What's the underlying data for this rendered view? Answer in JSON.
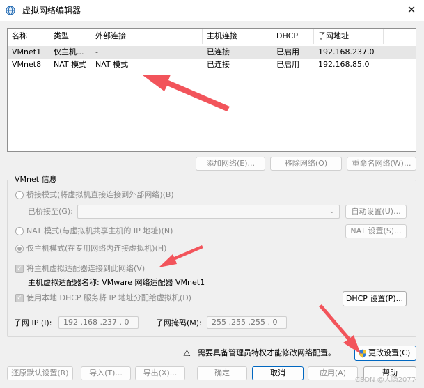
{
  "window": {
    "title": "虚拟网络编辑器",
    "close_glyph": "✕"
  },
  "table": {
    "columns": [
      "名称",
      "类型",
      "外部连接",
      "主机连接",
      "DHCP",
      "子网地址"
    ],
    "rows": [
      {
        "name": "VMnet1",
        "type": "仅主机...",
        "external": "-",
        "host": "已连接",
        "dhcp": "已启用",
        "subnet": "192.168.237.0",
        "selected": true
      },
      {
        "name": "VMnet8",
        "type": "NAT 模式",
        "external": "NAT 模式",
        "host": "已连接",
        "dhcp": "已启用",
        "subnet": "192.168.85.0",
        "selected": false
      }
    ]
  },
  "list_buttons": {
    "add": "添加网络(E)...",
    "remove": "移除网络(O)",
    "rename": "重命名网络(W)..."
  },
  "vmnet": {
    "group_label": "VMnet 信息",
    "bridged": "桥接模式(将虚拟机直接连接到外部网络)(B)",
    "bridged_to": "已桥接至(G):",
    "auto_settings": "自动设置(U)...",
    "nat": "NAT 模式(与虚拟机共享主机的 IP 地址)(N)",
    "nat_settings": "NAT 设置(S)...",
    "host_only": "仅主机模式(在专用网络内连接虚拟机)(H)",
    "connect_adapter": "将主机虚拟适配器连接到此网络(V)",
    "adapter_name": "主机虚拟适配器名称: VMware 网络适配器 VMnet1",
    "use_dhcp": "使用本地 DHCP 服务将 IP 地址分配给虚拟机(D)",
    "dhcp_settings": "DHCP 设置(P)...",
    "subnet_ip_label": "子网 IP (I):",
    "subnet_ip": "192 .168 .237 . 0",
    "mask_label": "子网掩码(M):",
    "mask": "255 .255 .255 . 0"
  },
  "admin": {
    "warning": "需要具备管理员特权才能修改网络配置。",
    "warning_glyph": "⚠",
    "change": "更改设置(C)"
  },
  "footer": {
    "restore": "还原默认设置(R)",
    "import": "导入(T)...",
    "export": "导出(X)...",
    "ok": "确定",
    "cancel": "取消",
    "apply": "应用(A)",
    "help": "帮助"
  },
  "watermark": "CSDN @大隐2077",
  "colors": {
    "arrow": "#f2545b",
    "primary_border": "#0067c0"
  }
}
